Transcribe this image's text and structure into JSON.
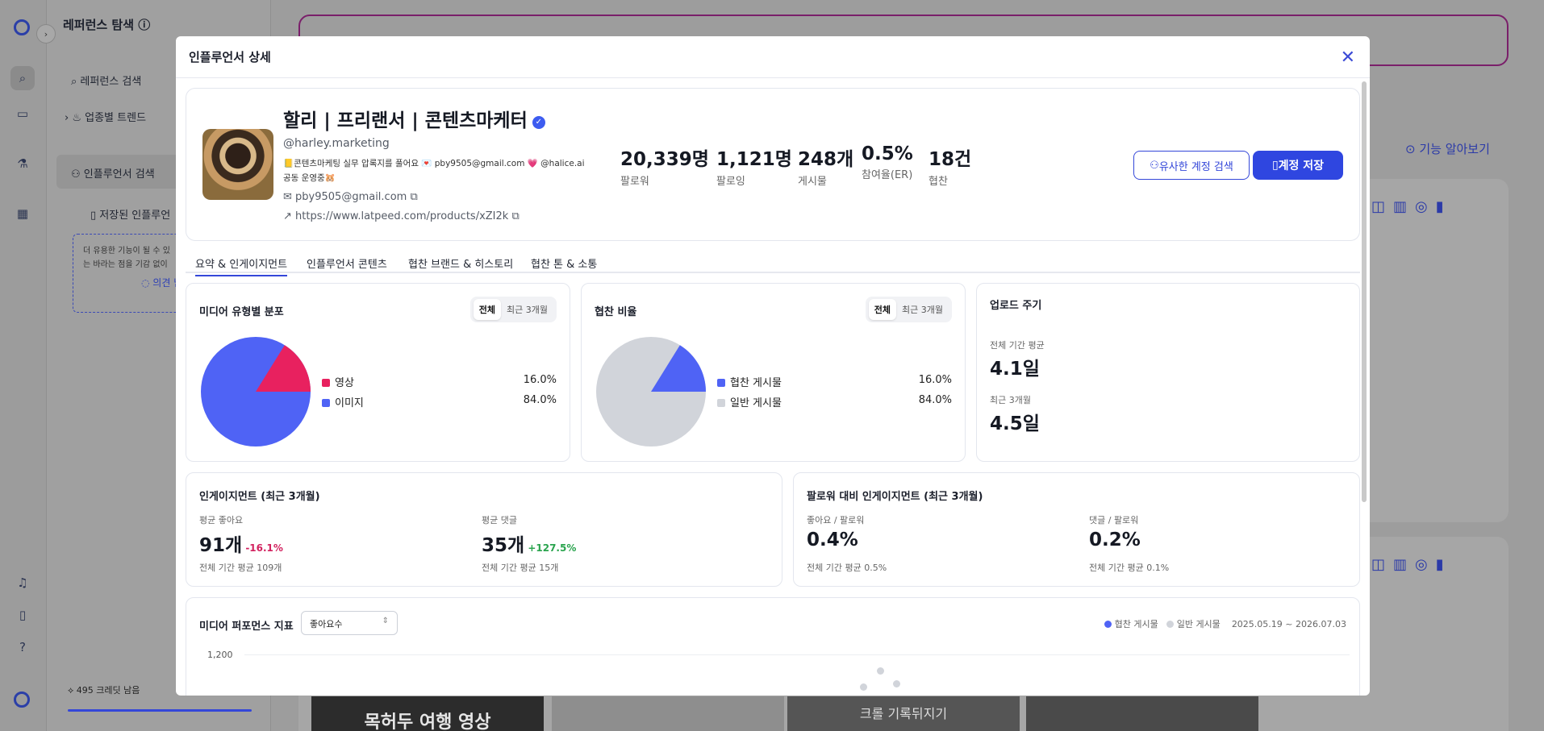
{
  "sidebar": {
    "title": "레퍼런스 탐색",
    "items": [
      "레퍼런스 검색",
      "업종별 트렌드",
      "인플루언서 검색",
      "저장된 인플루언"
    ],
    "note_line1": "더 유용한 기능이 될 수 있",
    "note_line2": "는 바라는 점을 기감 없이",
    "note_link": "의견 남",
    "credits": "495 크레딧 남음"
  },
  "background": {
    "learn_link": "기능 알아보기",
    "thumb_caption_1": "목허두 여행 영상",
    "thumb_caption_2": "크롤 기록뒤지기"
  },
  "modal": {
    "title": "인플루언서 상세",
    "close": "✕"
  },
  "profile": {
    "name": "할리 | 프리랜서 | 콘텐츠마케터",
    "handle": "@harley.marketing",
    "bio_line1": "📒콘텐츠마케팅 실무 압록지를 풀어요 💌 pby9505@gmail.com 💗 @halice.ai",
    "bio_line2": "공동 운영중🐹",
    "email": "pby9505@gmail.com",
    "url": "https://www.latpeed.com/products/xZI2k",
    "stats": [
      {
        "value": "20,339명",
        "label": "팔로워"
      },
      {
        "value": "1,121명",
        "label": "팔로잉"
      },
      {
        "value": "248개",
        "label": "게시물"
      },
      {
        "value": "0.5%",
        "label": "참여율(ER)"
      },
      {
        "value": "18건",
        "label": "협찬"
      }
    ],
    "similar_button": "유사한 계정 검색",
    "save_button": "계정 저장"
  },
  "tabs": [
    "요약 & 인게이지먼트",
    "인플루언서 콘텐츠",
    "협찬 브랜드 & 히스토리",
    "협찬 톤 & 소통"
  ],
  "media_dist": {
    "title": "미디어 유형별 분포",
    "seg_all": "전체",
    "seg_recent": "최근 3개월",
    "legend": [
      {
        "label": "영상",
        "value": "16.0%",
        "color": "#e8215f",
        "frac": 0.16
      },
      {
        "label": "이미지",
        "value": "84.0%",
        "color": "#4f63f5",
        "frac": 0.84
      }
    ]
  },
  "sponsor_ratio": {
    "title": "협찬 비율",
    "seg_all": "전체",
    "seg_recent": "최근 3개월",
    "legend": [
      {
        "label": "협찬 게시물",
        "value": "16.0%",
        "color": "#4f63f5",
        "frac": 0.16
      },
      {
        "label": "일반 게시물",
        "value": "84.0%",
        "color": "#d1d4da",
        "frac": 0.84
      }
    ]
  },
  "upload": {
    "title": "업로드 주기",
    "all_label": "전체 기간 평균",
    "all_value": "4.1일",
    "recent_label": "최근 3개월",
    "recent_value": "4.5일"
  },
  "engagement": {
    "title": "인게이지먼트 (최근 3개월)",
    "likes_label": "평균 좋아요",
    "likes_value": "91개",
    "likes_change": "-16.1%",
    "likes_note": "전체 기간 평균 109개",
    "comments_label": "평균 댓글",
    "comments_value": "35개",
    "comments_change": "+127.5%",
    "comments_note": "전체 기간 평균 15개"
  },
  "follower_eng": {
    "title": "팔로워 대비 인게이지먼트 (최근 3개월)",
    "lf_label": "좋아요 / 팔로워",
    "lf_value": "0.4%",
    "lf_note": "전체 기간 평균 0.5%",
    "cf_label": "댓글 / 팔로워",
    "cf_value": "0.2%",
    "cf_note": "전체 기간 평균 0.1%"
  },
  "performance": {
    "title": "미디어 퍼포먼스 지표",
    "select_value": "좋아요수",
    "legend_sponsor": "협찬 게시물",
    "legend_normal": "일반 게시물",
    "date_range": "2025.05.19 ~ 2026.07.03",
    "y_tick": "1,200"
  },
  "colors": {
    "accent": "#2f46e0",
    "pink": "#e8215f",
    "blue": "#4f63f5",
    "grey": "#d1d4da"
  }
}
